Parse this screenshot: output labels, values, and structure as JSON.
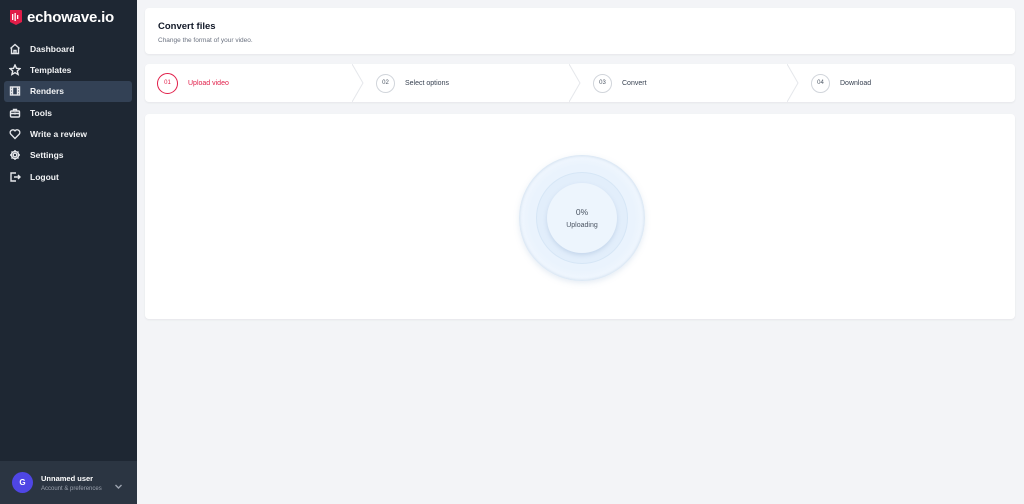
{
  "brand": {
    "name": "echowave.io",
    "accent": "#e11d48"
  },
  "sidebar": {
    "items": [
      {
        "label": "Dashboard",
        "icon": "home-icon",
        "active": false
      },
      {
        "label": "Templates",
        "icon": "star-icon",
        "active": false
      },
      {
        "label": "Renders",
        "icon": "film-icon",
        "active": true
      },
      {
        "label": "Tools",
        "icon": "toolbox-icon",
        "active": false
      },
      {
        "label": "Write a review",
        "icon": "heart-icon",
        "active": false
      },
      {
        "label": "Settings",
        "icon": "gear-icon",
        "active": false
      },
      {
        "label": "Logout",
        "icon": "logout-icon",
        "active": false
      }
    ],
    "user": {
      "initial": "G",
      "name": "Unnamed user",
      "subtitle": "Account & preferences"
    }
  },
  "header": {
    "title": "Convert files",
    "subtitle": "Change the format of your video."
  },
  "steps": [
    {
      "number": "01",
      "label": "Upload video",
      "active": true
    },
    {
      "number": "02",
      "label": "Select options",
      "active": false
    },
    {
      "number": "03",
      "label": "Convert",
      "active": false
    },
    {
      "number": "04",
      "label": "Download",
      "active": false
    }
  ],
  "upload": {
    "progress": "0%",
    "status": "Uploading"
  }
}
